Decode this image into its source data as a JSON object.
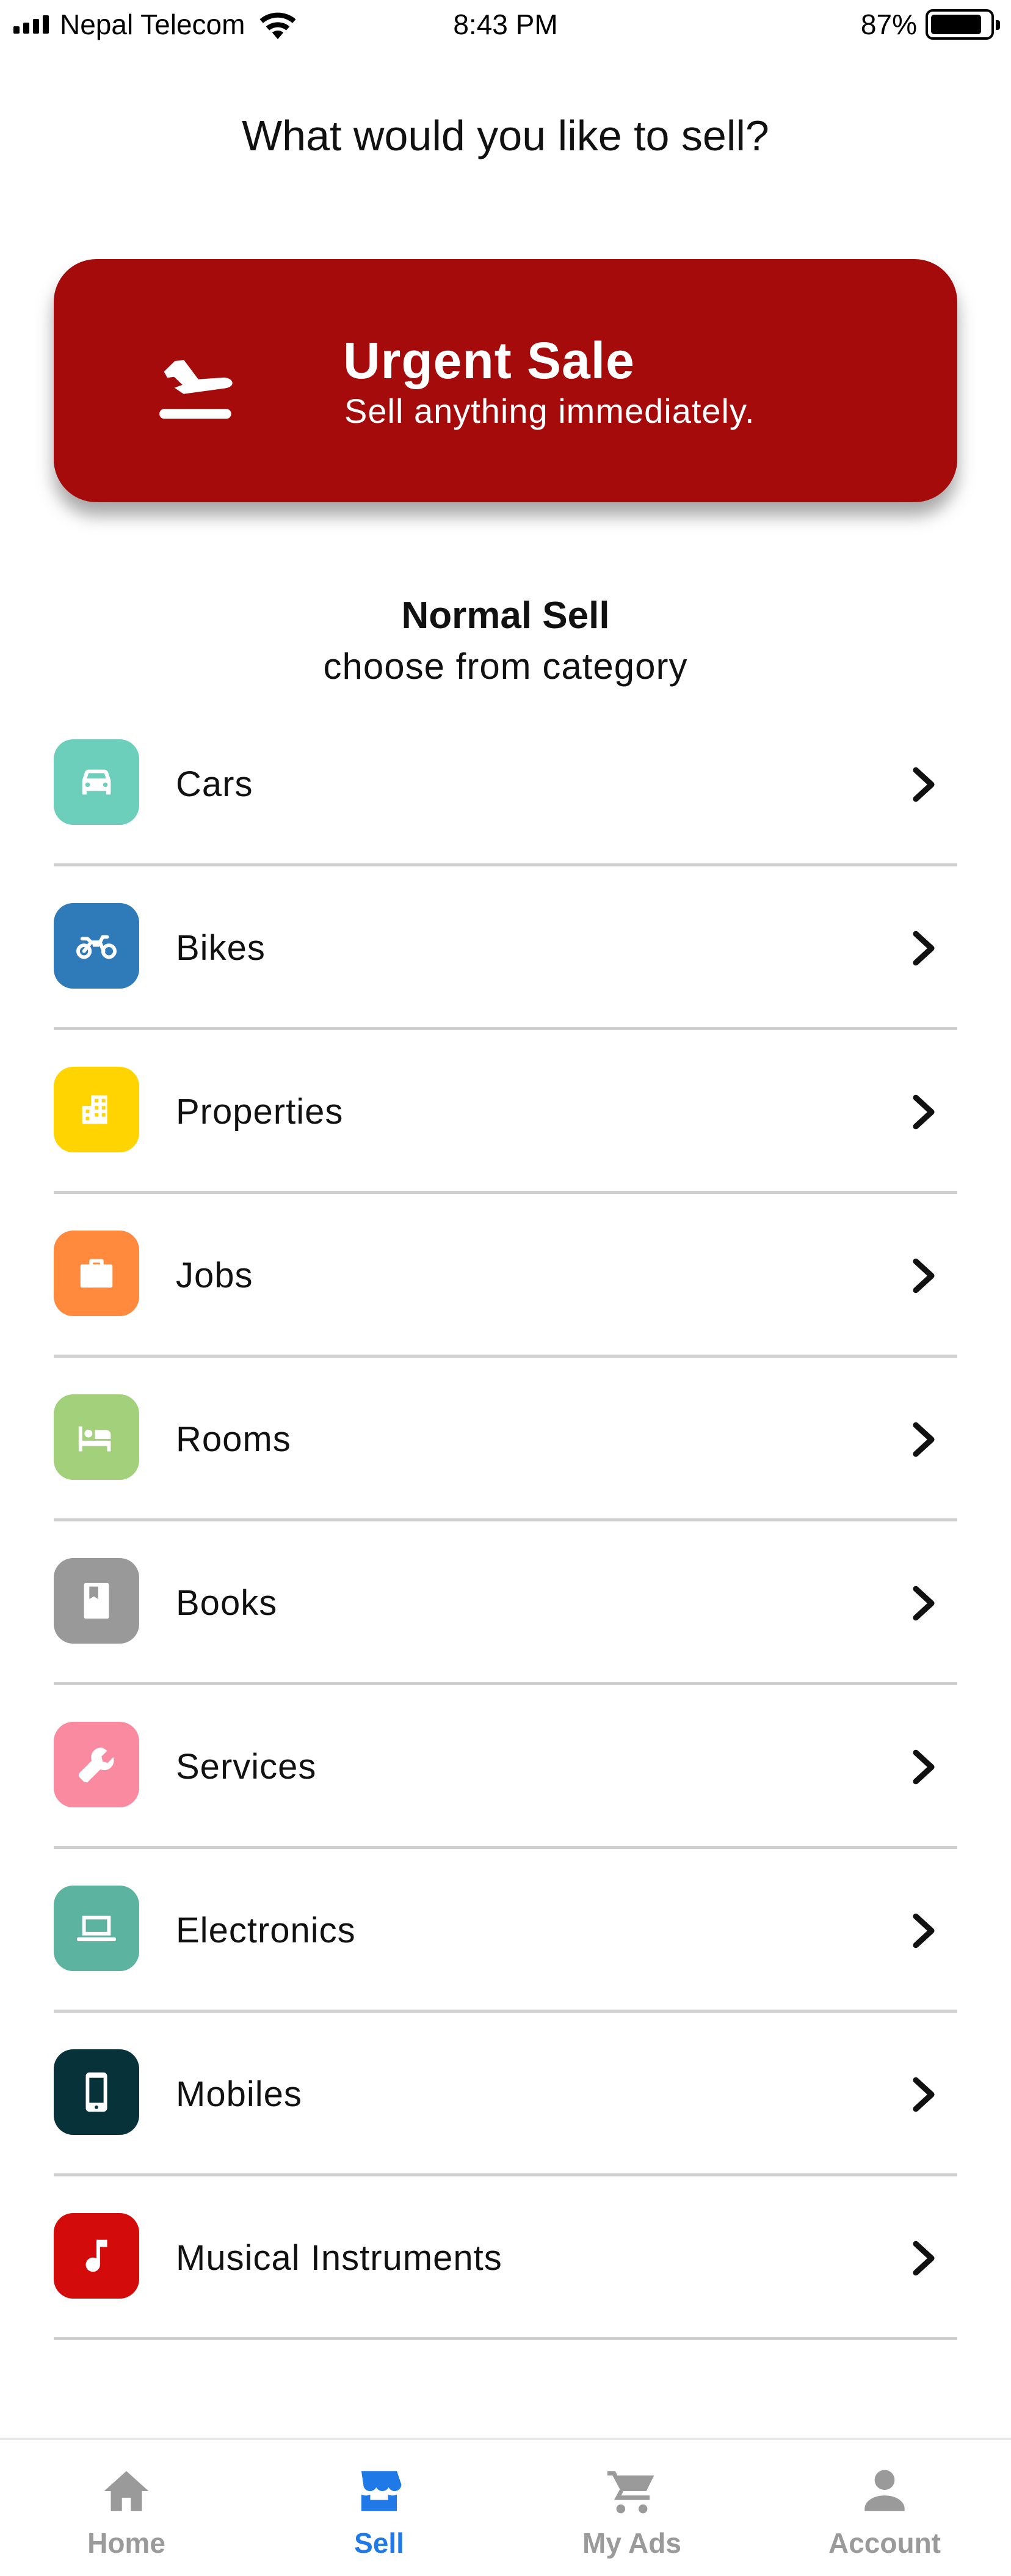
{
  "status_bar": {
    "carrier": "Nepal Telecom",
    "time": "8:43 PM",
    "battery_percent": "87%",
    "battery_level": 0.87
  },
  "header": {
    "title": "What would you like to sell?"
  },
  "urgent": {
    "title": "Urgent Sale",
    "subtitle": "Sell anything immediately.",
    "icon": "flight-takeoff-icon",
    "color": "#a60b0b"
  },
  "normal_sell": {
    "title": "Normal Sell",
    "subtitle": "choose from category"
  },
  "categories": [
    {
      "label": "Cars",
      "icon": "car-icon",
      "color": "#6ccfbb"
    },
    {
      "label": "Bikes",
      "icon": "motorcycle-icon",
      "color": "#2f7ab8"
    },
    {
      "label": "Properties",
      "icon": "apartment-icon",
      "color": "#ffd400"
    },
    {
      "label": "Jobs",
      "icon": "briefcase-icon",
      "color": "#ff8a3d"
    },
    {
      "label": "Rooms",
      "icon": "bed-icon",
      "color": "#a3d07a"
    },
    {
      "label": "Books",
      "icon": "book-icon",
      "color": "#999999"
    },
    {
      "label": "Services",
      "icon": "wrench-icon",
      "color": "#f98aa0"
    },
    {
      "label": "Electronics",
      "icon": "laptop-icon",
      "color": "#5cb39f"
    },
    {
      "label": "Mobiles",
      "icon": "smartphone-icon",
      "color": "#08323a"
    },
    {
      "label": "Musical Instruments",
      "icon": "music-note-icon",
      "color": "#d40b0b"
    }
  ],
  "bottom_nav": {
    "items": [
      {
        "label": "Home",
        "icon": "home-icon",
        "active": false
      },
      {
        "label": "Sell",
        "icon": "store-icon",
        "active": true
      },
      {
        "label": "My Ads",
        "icon": "cart-icon",
        "active": false
      },
      {
        "label": "Account",
        "icon": "person-icon",
        "active": false
      }
    ],
    "active_color": "#1f7ae8",
    "inactive_color": "#9a9a9a"
  }
}
